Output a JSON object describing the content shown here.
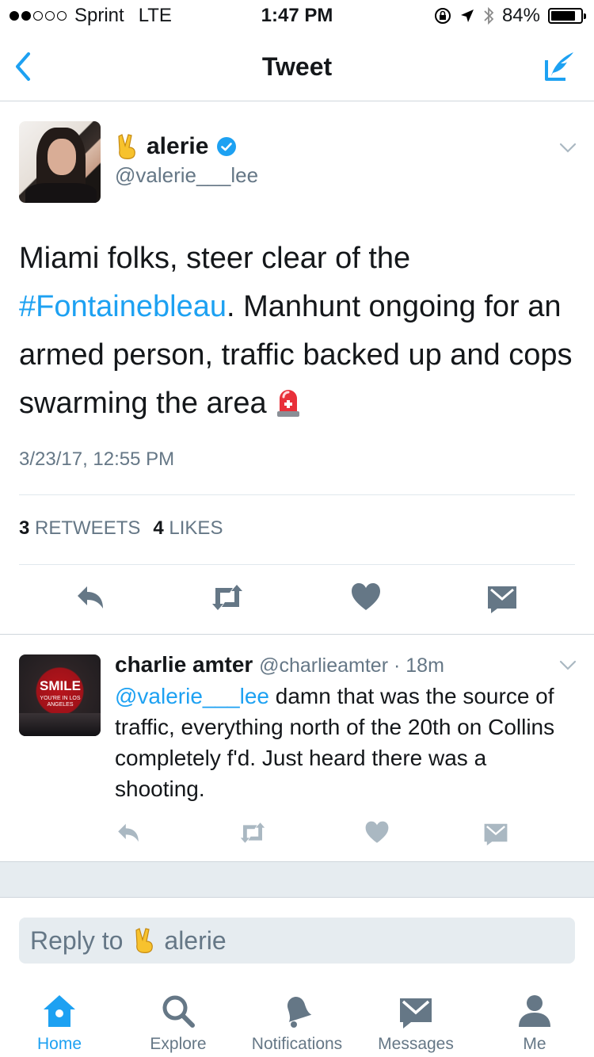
{
  "status_bar": {
    "carrier": "Sprint",
    "network": "LTE",
    "time": "1:47 PM",
    "battery": "84%",
    "battery_level": 0.84
  },
  "nav": {
    "title": "Tweet"
  },
  "tweet": {
    "name": "alerie",
    "handle": "@valerie___lee",
    "text_1": "Miami folks, steer clear of the ",
    "hashtag": "#Fontainebleau",
    "text_2": ". Manhunt ongoing for an armed person, traffic backed up and cops swarming the area",
    "timestamp": "3/23/17, 12:55 PM",
    "retweets_count": "3",
    "retweets_label": "RETWEETS",
    "likes_count": "4",
    "likes_label": "LIKES"
  },
  "reply": {
    "name": "charlie amter",
    "handle": "@charlieamter",
    "separator": " · ",
    "time": "18m",
    "mention": "@valerie___lee",
    "text": " damn that was the source of traffic, everything north of the 20th on Collins completely f'd. Just heard there was a shooting.",
    "avatar_text": "SMILE",
    "avatar_subtext": "YOU'RE IN LOS ANGELES"
  },
  "reply_box": {
    "prefix": "Reply to",
    "name": "alerie"
  },
  "tabs": [
    {
      "label": "Home",
      "icon": "home-icon",
      "active": true
    },
    {
      "label": "Explore",
      "icon": "search-icon",
      "active": false
    },
    {
      "label": "Notifications",
      "icon": "bell-icon",
      "active": false
    },
    {
      "label": "Messages",
      "icon": "envelope-icon",
      "active": false
    },
    {
      "label": "Me",
      "icon": "person-icon",
      "active": false
    }
  ],
  "colors": {
    "accent": "#1da1f2",
    "muted": "#657786",
    "text": "#14171a",
    "divider": "#e1e8ed",
    "background_gray": "#e6ecf0"
  }
}
